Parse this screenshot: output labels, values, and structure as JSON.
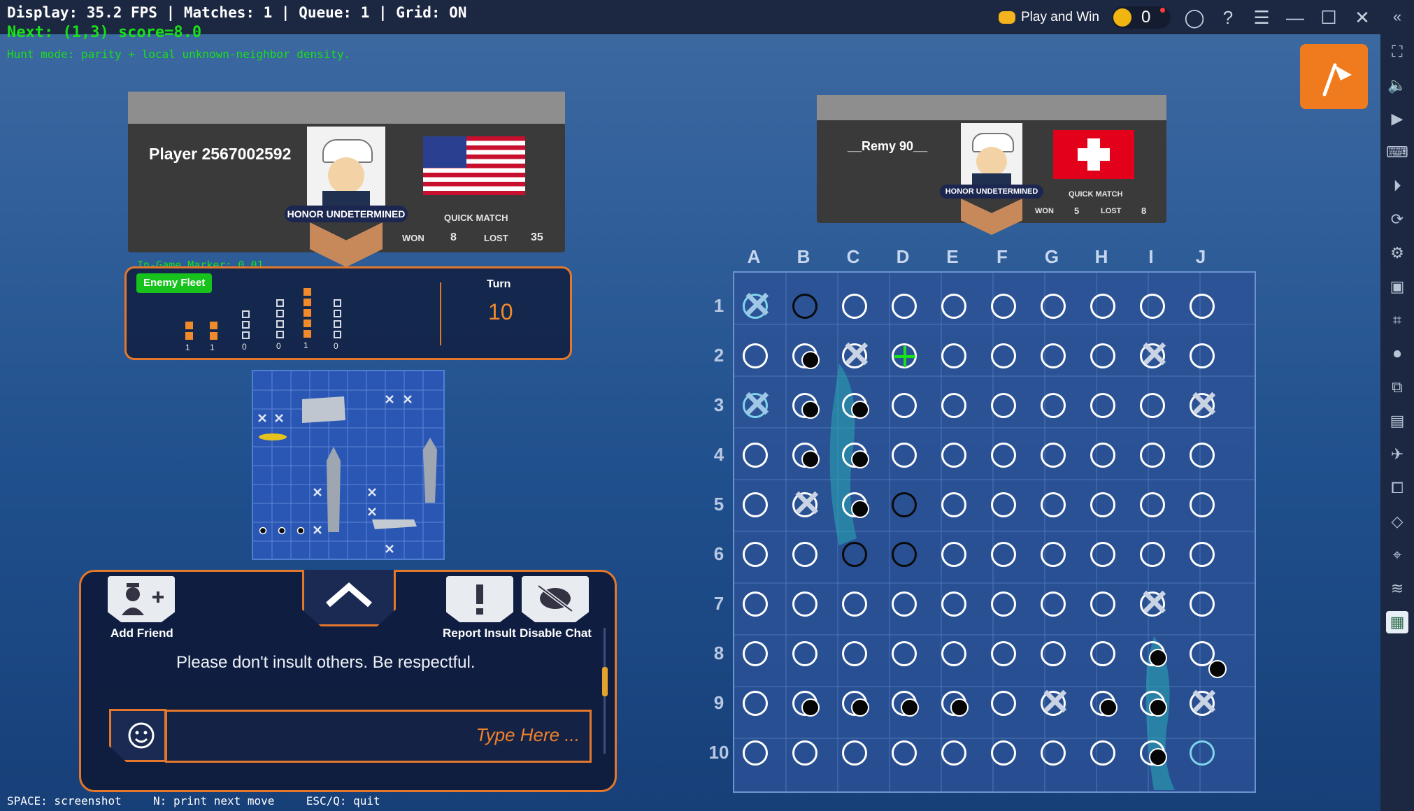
{
  "overlay": {
    "line1": "Display: 35.2 FPS | Matches: 1 | Queue: 1 | Grid: ON",
    "line2": "Next: (1,3) score=8.0",
    "line3": "Hunt mode: parity + local unknown-neighbor density.",
    "marker": "In-Game Marker: 0.01",
    "footer": [
      "SPACE: screenshot",
      "N: print next move",
      "ESC/Q: quit"
    ],
    "colors": {
      "primary": "#ffffff",
      "secondary": "#19e019"
    }
  },
  "topbar": {
    "play_and_win": "Play and Win",
    "coins": "0"
  },
  "player": {
    "name": "Player 2567002592",
    "honor": "HONOR UNDETERMINED",
    "mode": "QUICK MATCH",
    "won_label": "WON",
    "won": "8",
    "lost_label": "LOST",
    "lost": "35",
    "flag": "us-flag"
  },
  "opponent": {
    "name": "__Remy 90__",
    "honor": "HONOR UNDETERMINED",
    "mode": "QUICK MATCH",
    "won_label": "WON",
    "won": "5",
    "lost_label": "LOST",
    "lost": "8",
    "flag": "swiss-flag"
  },
  "fleet": {
    "title": "Enemy Fleet",
    "counts": [
      "1",
      "1",
      "0",
      "0",
      "1",
      "0"
    ],
    "turn_label": "Turn",
    "turn": "10"
  },
  "chat": {
    "add_friend": "Add Friend",
    "report_insult": "Report Insult",
    "disable_chat": "Disable Chat",
    "notice": "Please don't insult others. Be respectful.",
    "placeholder": "Type Here ..."
  },
  "grid": {
    "columns": [
      "A",
      "B",
      "C",
      "D",
      "E",
      "F",
      "G",
      "H",
      "I",
      "J"
    ],
    "rows": [
      "1",
      "2",
      "3",
      "4",
      "5",
      "6",
      "7",
      "8",
      "9",
      "10"
    ],
    "legend": {
      "o": "unknown",
      "x": "miss",
      "h": "hit",
      "b": "black-ring",
      "c": "cyan-ring",
      "t": "target",
      "X": "cyan-miss"
    },
    "cells": [
      "Xbooooooo",
      "ohxtooooxo",
      "Xhhooooooxo",
      "ohhooooooo",
      "oxhbooooooo",
      "oobboooooo",
      "oooooooox o",
      "oooooooohdo",
      "ohhhhoxhhx",
      "ooooooooh c"
    ]
  },
  "accent_colors": {
    "orange": "#e3772c",
    "green": "#19e019"
  }
}
